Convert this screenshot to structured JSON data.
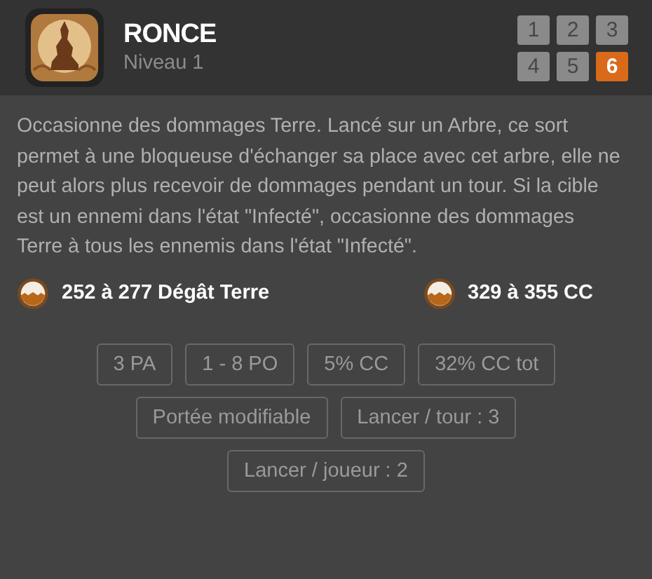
{
  "spell": {
    "name": "RONCE",
    "level_label": "Niveau 1"
  },
  "levels": [
    {
      "label": "1",
      "selected": false
    },
    {
      "label": "2",
      "selected": false
    },
    {
      "label": "3",
      "selected": false
    },
    {
      "label": "4",
      "selected": false
    },
    {
      "label": "5",
      "selected": false
    },
    {
      "label": "6",
      "selected": true
    }
  ],
  "description": "Occasionne des dommages Terre. Lancé sur un Arbre, ce sort permet à une bloqueuse d'échanger sa place avec cet arbre, elle ne peut alors plus recevoir de dommages pendant un tour. Si la cible est un ennemi dans l'état \"Infecté\", occasionne des dommages Terre à tous les ennemis dans l'état \"Infecté\".",
  "effects": [
    {
      "text": "252 à 277 Dégât Terre"
    },
    {
      "text": "329 à 355 CC"
    }
  ],
  "tags": [
    [
      "3 PA",
      "1 - 8 PO",
      "5% CC",
      "32% CC tot"
    ],
    [
      "Portée modifiable",
      "Lancer / tour : 3"
    ],
    [
      "Lancer / joueur : 2"
    ]
  ]
}
